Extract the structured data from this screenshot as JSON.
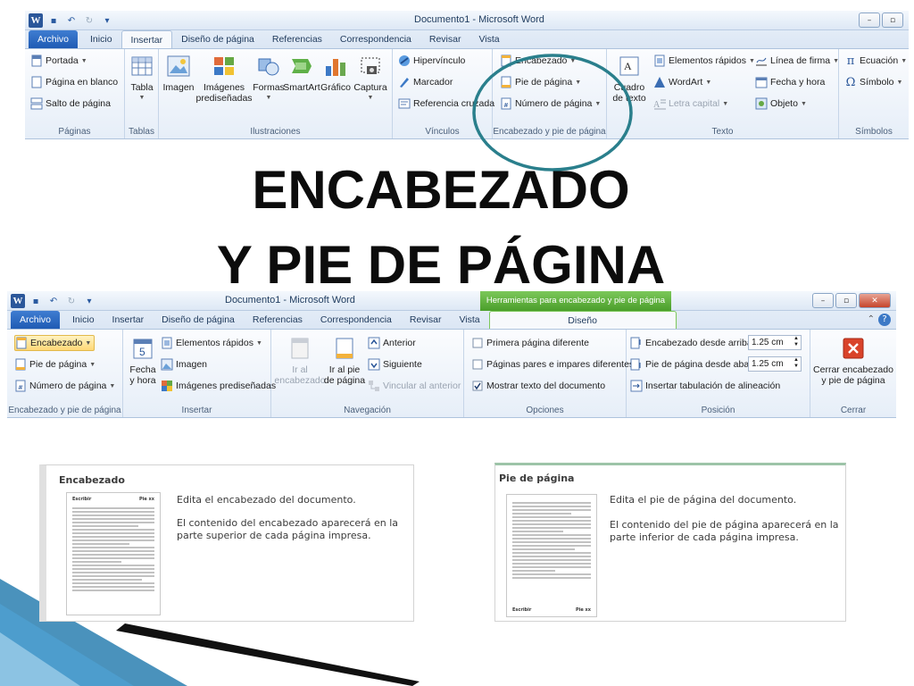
{
  "top_ribbon": {
    "window_title": "Documento1 - Microsoft Word",
    "tabs": [
      "Archivo",
      "Inicio",
      "Insertar",
      "Diseño de página",
      "Referencias",
      "Correspondencia",
      "Revisar",
      "Vista"
    ],
    "active_tab": "Insertar",
    "groups": {
      "paginas": {
        "label": "Páginas",
        "items": [
          "Portada",
          "Página en blanco",
          "Salto de página"
        ]
      },
      "tablas": {
        "label": "Tablas",
        "items": [
          "Tabla"
        ]
      },
      "ilustraciones": {
        "label": "Ilustraciones",
        "items": [
          "Imagen",
          "Imágenes prediseñadas",
          "Formas",
          "SmartArt",
          "Gráfico",
          "Captura"
        ]
      },
      "vinculos": {
        "label": "Vínculos",
        "items": [
          "Hipervínculo",
          "Marcador",
          "Referencia cruzada"
        ]
      },
      "encabezado_pie": {
        "label": "Encabezado y pie de página",
        "items": [
          "Encabezado",
          "Pie de página",
          "Número de página"
        ]
      },
      "texto": {
        "label": "Texto",
        "items": [
          "Cuadro de texto",
          "Elementos rápidos",
          "WordArt",
          "Letra capital",
          "Línea de firma",
          "Fecha y hora",
          "Objeto"
        ]
      },
      "simbolos": {
        "label": "Símbolos",
        "items": [
          "Ecuación",
          "Símbolo"
        ]
      }
    }
  },
  "title": {
    "line1": "ENCABEZADO",
    "line2": "Y PIE DE PÁGINA"
  },
  "bottom_ribbon": {
    "window_title": "Documento1 - Microsoft Word",
    "context_title": "Herramientas para encabezado y pie de página",
    "tabs": [
      "Archivo",
      "Inicio",
      "Insertar",
      "Diseño de página",
      "Referencias",
      "Correspondencia",
      "Revisar",
      "Vista",
      "Diseño"
    ],
    "active_tab": "Diseño",
    "groups": {
      "encabezado_pie": {
        "label": "Encabezado y pie de página",
        "items": [
          "Encabezado",
          "Pie de página",
          "Número de página"
        ]
      },
      "insertar": {
        "label": "Insertar",
        "items": [
          "Fecha y hora",
          "Elementos rápidos",
          "Imagen",
          "Imágenes prediseñadas"
        ]
      },
      "navegacion": {
        "label": "Navegación",
        "items": [
          "Ir al encabezado",
          "Ir al pie de página",
          "Anterior",
          "Siguiente",
          "Vincular al anterior"
        ]
      },
      "opciones": {
        "label": "Opciones",
        "items": [
          "Primera página diferente",
          "Páginas pares e impares diferentes",
          "Mostrar texto del documento"
        ],
        "checked": [
          false,
          false,
          true
        ]
      },
      "posicion": {
        "label": "Posición",
        "items": [
          "Encabezado desde arriba:",
          "Pie de página desde abajo:",
          "Insertar tabulación de alineación"
        ],
        "values": [
          "1.25 cm",
          "1.25 cm"
        ]
      },
      "cerrar": {
        "label": "Cerrar",
        "items": [
          "Cerrar encabezado y pie de página"
        ]
      }
    }
  },
  "tooltip_header": {
    "title": "Encabezado",
    "thumb_left": "Escribir",
    "thumb_right": "Pie xx",
    "line1": "Edita el encabezado del documento.",
    "line2": "El contenido del encabezado aparecerá en la parte superior de cada página impresa."
  },
  "tooltip_footer": {
    "title": "Pie de página",
    "thumb_left": "Escribir",
    "thumb_right": "Pie xx",
    "line1": "Edita el pie de página del documento.",
    "line2": "El contenido del pie de página aparecerá en la parte inferior de cada página impresa."
  },
  "colors": {
    "highlight_circle": "#2a7f8c",
    "accent_blue": "#2b579a",
    "context_green": "#5aa832",
    "corner_dark": "#111111",
    "corner_blue": "#2a7fb0"
  }
}
